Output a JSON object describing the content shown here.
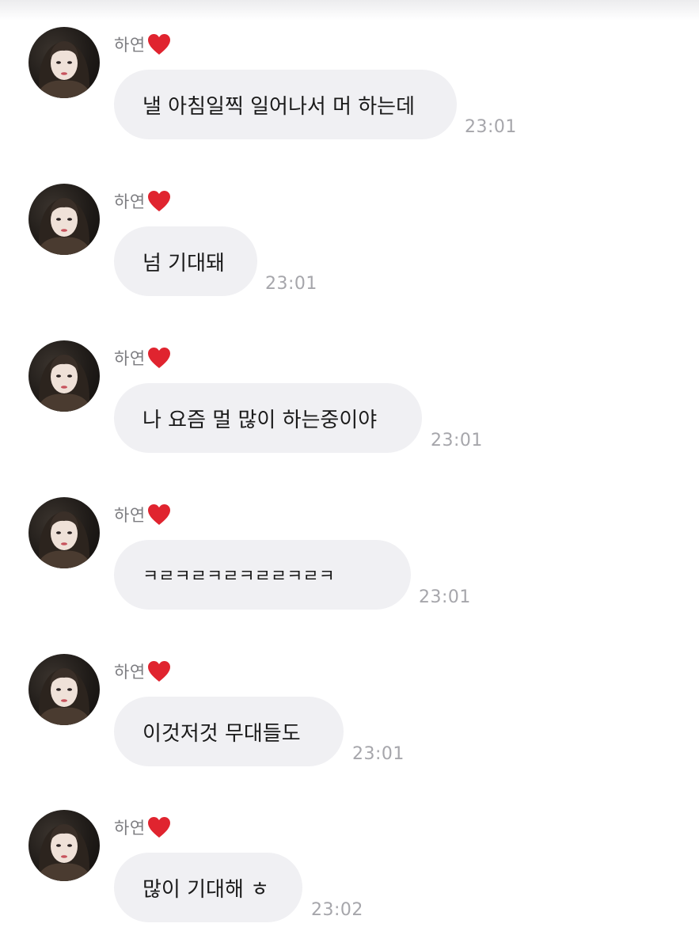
{
  "chat": {
    "messages": [
      {
        "sender": "하연",
        "sender_icon": "red-heart-emoji",
        "text": "낼 아침일찍 일어나서 머 하는데",
        "time": "23:01"
      },
      {
        "sender": "하연",
        "sender_icon": "red-heart-emoji",
        "text": "넘 기대돼",
        "time": "23:01"
      },
      {
        "sender": "하연",
        "sender_icon": "red-heart-emoji",
        "text": "나 요즘 멀 많이 하는중이야",
        "time": "23:01"
      },
      {
        "sender": "하연",
        "sender_icon": "red-heart-emoji",
        "text": "ㅋㄹㅋㄹㅋㄹㅋㄹㄹㅋㄹㅋ",
        "time": "23:01"
      },
      {
        "sender": "하연",
        "sender_icon": "red-heart-emoji",
        "text": "이것저것 무대들도",
        "time": "23:01"
      },
      {
        "sender": "하연",
        "sender_icon": "red-heart-emoji",
        "text": "많이 기대해 ㅎ",
        "time": "23:02"
      }
    ]
  },
  "colors": {
    "bubble_bg": "#f0f0f3",
    "message_text": "#1a1a1a",
    "sender_text": "#7c7c80",
    "timestamp_text": "#a6a6ab",
    "heart": "#e0242f"
  }
}
